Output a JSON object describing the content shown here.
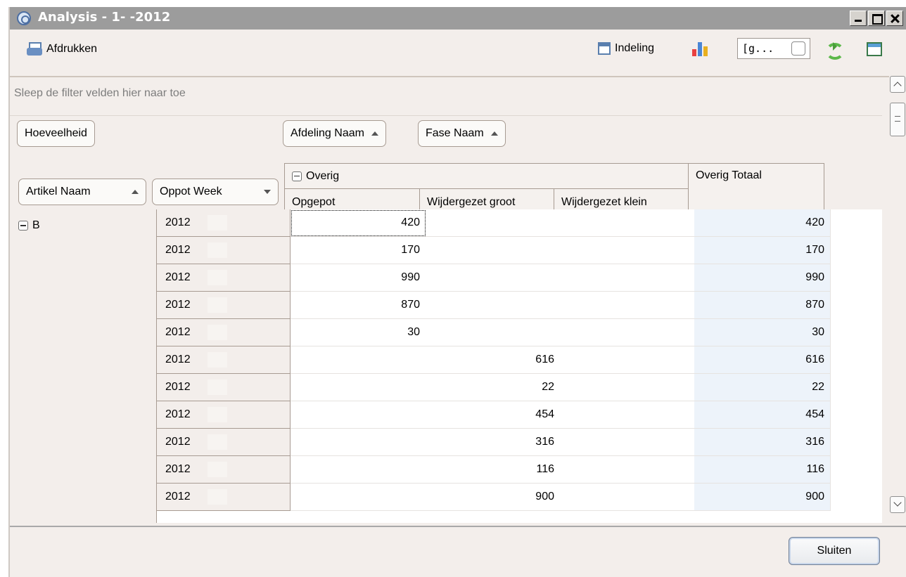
{
  "window": {
    "title": "Analysis - 1-  -2012"
  },
  "toolbar": {
    "print_label": "Afdrukken",
    "layout_label": "Indeling",
    "field_value": "[g..."
  },
  "filter": {
    "hint": "Sleep de filter velden hier naar toe"
  },
  "pivot": {
    "data_field": "Hoeveelheid",
    "column_fields": [
      "Afdeling Naam",
      "Fase Naam"
    ],
    "row_fields": [
      "Artikel Naam",
      "Oppot Week"
    ],
    "column_group": "Overig",
    "total_header": "Overig Totaal",
    "columns": [
      "Opgepot",
      "Wijdergezet groot",
      "Wijdergezet klein"
    ],
    "row_group": "B",
    "rows": [
      {
        "week": "2012",
        "opgepot": "420",
        "groot": "",
        "klein": "",
        "totaal": "420"
      },
      {
        "week": "2012",
        "opgepot": "170",
        "groot": "",
        "klein": "",
        "totaal": "170"
      },
      {
        "week": "2012",
        "opgepot": "990",
        "groot": "",
        "klein": "",
        "totaal": "990"
      },
      {
        "week": "2012",
        "opgepot": "870",
        "groot": "",
        "klein": "",
        "totaal": "870"
      },
      {
        "week": "2012",
        "opgepot": "30",
        "groot": "",
        "klein": "",
        "totaal": "30"
      },
      {
        "week": "2012",
        "opgepot": "",
        "groot": "616",
        "klein": "",
        "totaal": "616"
      },
      {
        "week": "2012",
        "opgepot": "",
        "groot": "22",
        "klein": "",
        "totaal": "22"
      },
      {
        "week": "2012",
        "opgepot": "",
        "groot": "454",
        "klein": "",
        "totaal": "454"
      },
      {
        "week": "2012",
        "opgepot": "",
        "groot": "316",
        "klein": "",
        "totaal": "316"
      },
      {
        "week": "2012",
        "opgepot": "",
        "groot": "116",
        "klein": "",
        "totaal": "116"
      },
      {
        "week": "2012",
        "opgepot": "",
        "groot": "900",
        "klein": "",
        "totaal": "900"
      }
    ]
  },
  "footer": {
    "close_label": "Sluiten"
  },
  "colors": {
    "titlebar": "#9c9c9c",
    "total_column": "#edf3fa",
    "panel": "#f3eeeb"
  }
}
